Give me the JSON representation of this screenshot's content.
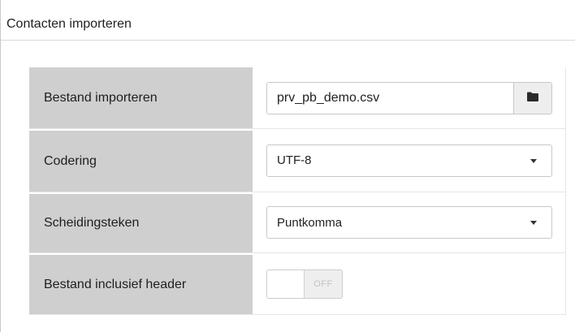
{
  "panel": {
    "title": "Contacten importeren"
  },
  "form": {
    "rows": [
      {
        "label": "Bestand importeren"
      },
      {
        "label": "Codering"
      },
      {
        "label": "Scheidingsteken"
      },
      {
        "label": "Bestand inclusief header"
      }
    ],
    "file": {
      "value": "prv_pb_demo.csv",
      "browse_icon": "folder-icon"
    },
    "encoding": {
      "selected": "UTF-8",
      "icon": "caret-down-icon"
    },
    "delimiter": {
      "selected": "Puntkomma",
      "icon": "caret-down-icon"
    },
    "header_toggle": {
      "state_label": "OFF",
      "on": false
    }
  }
}
